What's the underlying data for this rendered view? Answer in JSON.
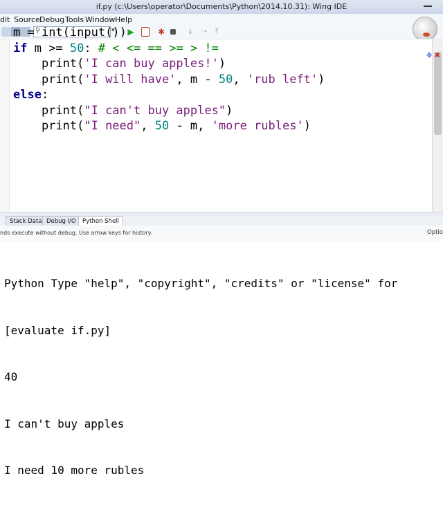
{
  "window": {
    "title": "if.py (c:\\Users\\operator\\Documents\\Python\\2014.10.31): Wing IDE"
  },
  "menu": {
    "items": [
      "dit",
      "Source",
      "Debug",
      "Tools",
      "Window",
      "Help"
    ]
  },
  "toolbar": {
    "search_value": "",
    "dropdown_glyph": "▾",
    "icons": [
      "new-file-icon",
      "save-icon",
      "search-icon",
      "run-icon",
      "debug-icon",
      "bug-icon",
      "stop-icon",
      "step-into-icon",
      "step-over-icon",
      "step-out-icon"
    ]
  },
  "editor": {
    "code_lines": [
      [
        {
          "t": "m = ",
          "c": "op"
        },
        {
          "t": "int",
          "c": "op"
        },
        {
          "t": "(",
          "c": "op"
        },
        {
          "t": "input",
          "c": "op"
        },
        {
          "t": "())",
          "c": "op"
        }
      ],
      [
        {
          "t": "if",
          "c": "kw"
        },
        {
          "t": " m >= ",
          "c": "op"
        },
        {
          "t": "50",
          "c": "num"
        },
        {
          "t": ": ",
          "c": "op"
        },
        {
          "t": "# < <= == >= > !=",
          "c": "cmt"
        }
      ],
      [
        {
          "t": "    print(",
          "c": "op"
        },
        {
          "t": "'I can buy apples!'",
          "c": "str"
        },
        {
          "t": ")",
          "c": "op"
        }
      ],
      [
        {
          "t": "    print(",
          "c": "op"
        },
        {
          "t": "'I will have'",
          "c": "str"
        },
        {
          "t": ", m - ",
          "c": "op"
        },
        {
          "t": "50",
          "c": "num"
        },
        {
          "t": ", ",
          "c": "op"
        },
        {
          "t": "'rub left'",
          "c": "str"
        },
        {
          "t": ")",
          "c": "op"
        }
      ],
      [
        {
          "t": "else",
          "c": "kw"
        },
        {
          "t": ":",
          "c": "op"
        }
      ],
      [
        {
          "t": "    print(",
          "c": "op"
        },
        {
          "t": "\"I can't buy apples\"",
          "c": "str"
        },
        {
          "t": ")",
          "c": "op"
        }
      ],
      [
        {
          "t": "    print(",
          "c": "op"
        },
        {
          "t": "\"I need\"",
          "c": "str"
        },
        {
          "t": ", ",
          "c": "op"
        },
        {
          "t": "50",
          "c": "num"
        },
        {
          "t": " - m, ",
          "c": "op"
        },
        {
          "t": "'more rubles'",
          "c": "str"
        },
        {
          "t": ")",
          "c": "op"
        }
      ]
    ]
  },
  "tabs": [
    {
      "label": "Stack Data",
      "active": false
    },
    {
      "label": "Debug I/O",
      "active": false
    },
    {
      "label": "Python Shell",
      "active": true
    }
  ],
  "shell": {
    "hint": "nds execute without debug.  Use arrow keys for history.",
    "options_label": "Optio",
    "lines": [
      "Python Type \"help\", \"copyright\", \"credits\" or \"license\" for",
      "[evaluate if.py]",
      "40",
      "I can't buy apples",
      "I need 10 more rubles"
    ]
  },
  "colors": {
    "keyword": "#00008b",
    "string": "#7a1f7a",
    "number": "#008080",
    "comment": "#008000"
  }
}
